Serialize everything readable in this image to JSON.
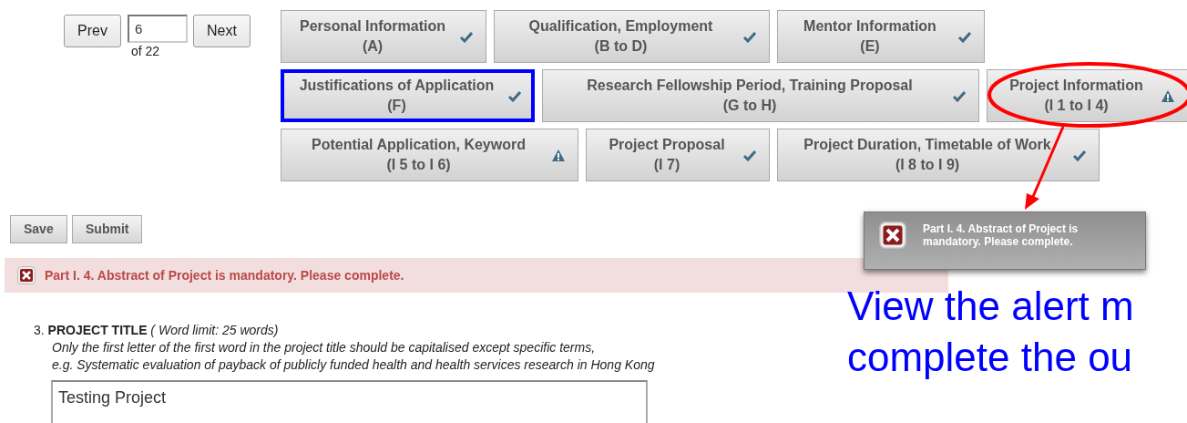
{
  "pager": {
    "prev": "Prev",
    "page": "6",
    "of": "of 22",
    "next": "Next"
  },
  "sections": [
    {
      "title": "Personal Information",
      "range": "(A)",
      "complete": true,
      "boxed": false,
      "circled": false
    },
    {
      "title": "Qualification, Employment",
      "range": "(B to D)",
      "complete": true,
      "boxed": false,
      "circled": false
    },
    {
      "title": "Mentor Information",
      "range": "(E)",
      "complete": true,
      "boxed": false,
      "circled": false
    },
    {
      "title": "Justifications of Application",
      "range": "(F)",
      "complete": true,
      "boxed": true,
      "circled": false
    },
    {
      "title": "Research Fellowship Period, Training Proposal",
      "range": "(G to H)",
      "complete": true,
      "boxed": false,
      "circled": false
    },
    {
      "title": "Project Information",
      "range": "(I 1 to I 4)",
      "complete": false,
      "boxed": false,
      "circled": true
    },
    {
      "title": "Potential Application, Keyword",
      "range": "(I 5 to I 6)",
      "complete": false,
      "boxed": false,
      "circled": false
    },
    {
      "title": "Project Proposal",
      "range": "(I 7)",
      "complete": true,
      "boxed": false,
      "circled": false
    },
    {
      "title": "Project Duration, Timetable of Work",
      "range": "(I 8 to I 9)",
      "complete": true,
      "boxed": false,
      "circled": false
    }
  ],
  "actions": [
    "Save",
    "Submit"
  ],
  "alert": "Part I. 4. Abstract of Project is mandatory. Please complete.",
  "toast": "Part I. 4. Abstract of Project is mandatory. Please complete.",
  "caption": [
    "View the alert m",
    "complete the ou"
  ],
  "question": {
    "number": "3.",
    "title": "PROJECT TITLE",
    "limit": "( Word limit: 25 words)",
    "hints": [
      "Only the first letter of the first word in the project title should be capitalised except specific terms,",
      "e.g. Systematic evaluation of payback of publicly funded health and health services research in Hong Kong"
    ],
    "value": "Testing Project"
  }
}
